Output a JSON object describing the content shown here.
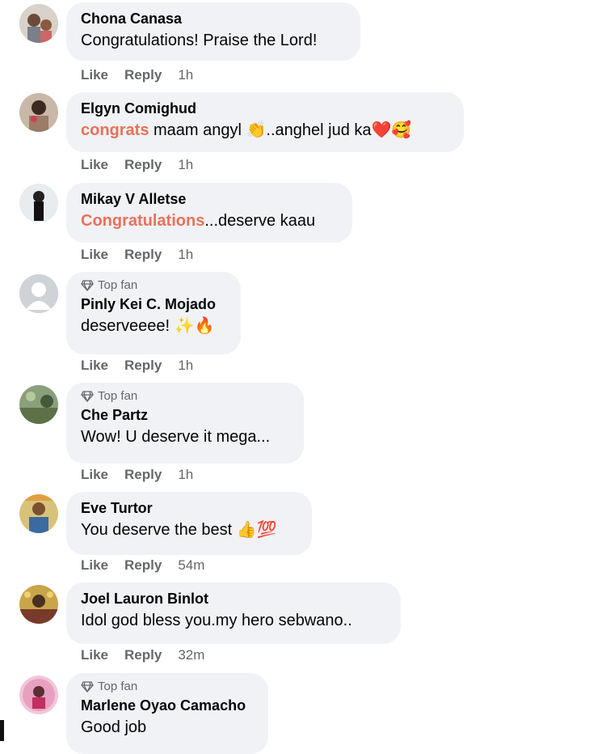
{
  "actions": {
    "like": "Like",
    "reply": "Reply"
  },
  "top_fan_label": "Top fan",
  "comments": [
    {
      "name": "Chona Canasa",
      "text": "Congratulations! Praise the Lord!",
      "time": "1h"
    },
    {
      "name": "Elgyn Comighud",
      "highlight": "congrats",
      "text": " maam angyl 👏..anghel jud ka❤️🥰",
      "time": "1h"
    },
    {
      "name": "Mikay V Alletse",
      "highlight": "Congratulations",
      "text": "...deserve kaau",
      "time": "1h"
    },
    {
      "name": "Pinly Kei C. Mojado",
      "top_fan": true,
      "text": "deserveeee! ✨🔥",
      "time": "1h"
    },
    {
      "name": "Che Partz",
      "top_fan": true,
      "text": "Wow! U deserve it mega...",
      "time": "1h"
    },
    {
      "name": "Eve Turtor",
      "text": "You deserve the best 👍💯",
      "time": "54m"
    },
    {
      "name": "Joel Lauron Binlot",
      "text": "Idol god bless you.my hero sebwano..",
      "time": "32m"
    },
    {
      "name": "Marlene Oyao Camacho",
      "top_fan": true,
      "text": "Good job",
      "time": ""
    }
  ],
  "colors": {
    "bubble": "#f0f2f5",
    "highlight": "#e9715a",
    "meta": "#65676b"
  }
}
